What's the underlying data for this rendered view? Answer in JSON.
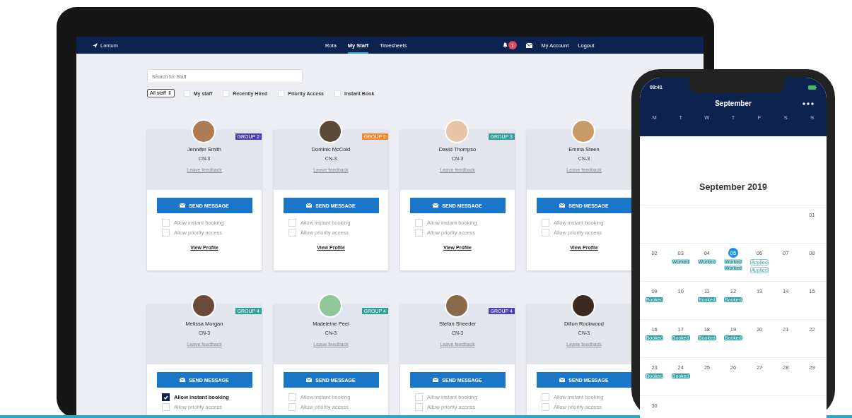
{
  "laptop": {
    "nav": {
      "brand": "Lantum",
      "links": [
        {
          "label": "Rota",
          "selected": false
        },
        {
          "label": "My Staff",
          "selected": true
        },
        {
          "label": "Timesheets",
          "selected": false
        }
      ],
      "notification_count": "1",
      "account": "My Account",
      "logout": "Logout"
    },
    "search": {
      "placeholder": "Search for Staff"
    },
    "filters": {
      "dropdown": "All staff ⇕",
      "options": [
        {
          "label": "My staff",
          "checked": false
        },
        {
          "label": "Recently Hired",
          "checked": false
        },
        {
          "label": "Priority Access",
          "checked": false
        },
        {
          "label": "Instant Book",
          "checked": false
        }
      ]
    },
    "staff": [
      {
        "name": "Jennifer Smith",
        "grade": "CN-3",
        "feedback": "Leave feedback",
        "badge": {
          "label": "GROUP 2",
          "color": "#4b3fb5"
        },
        "button": "SEND MESSAGE",
        "instant_booking": {
          "label": "Allow instant booking",
          "checked": false
        },
        "priority_access": {
          "label": "Allow priority access",
          "checked": false
        },
        "profile": "View Profile"
      },
      {
        "name": "Dominic McCold",
        "grade": "CN-3",
        "feedback": "Leave feedback",
        "badge": {
          "label": "GROUP 1",
          "color": "#f08a2c"
        },
        "button": "SEND MESSAGE",
        "instant_booking": {
          "label": "Allow instant booking",
          "checked": false
        },
        "priority_access": {
          "label": "Allow priority access",
          "checked": false
        },
        "profile": "View Profile"
      },
      {
        "name": "David Thompso",
        "grade": "CN-3",
        "feedback": "Leave feedback",
        "badge": {
          "label": "GROUP 3",
          "color": "#2e9e97"
        },
        "button": "SEND MESSAGE",
        "instant_booking": {
          "label": "Allow instant booking",
          "checked": false
        },
        "priority_access": {
          "label": "Allow priority access",
          "checked": false
        },
        "profile": "View Profile"
      },
      {
        "name": "Emma Steen",
        "grade": "CN-3",
        "feedback": "Leave feedback",
        "button": "SEND MESSAGE",
        "instant_booking": {
          "label": "Allow instant booking",
          "checked": false
        },
        "priority_access": {
          "label": "Allow priority access",
          "checked": false
        },
        "profile": "View Profile"
      },
      {
        "name": "Melissa Morgan",
        "grade": "CN-3",
        "feedback": "Leave feedback",
        "badge": {
          "label": "GROUP 4",
          "color": "#2e9e97"
        },
        "button": "SEND MESSAGE",
        "instant_booking": {
          "label": "Allow instant booking",
          "checked": true
        },
        "priority_access": {
          "label": "Allow priority access",
          "checked": false
        }
      },
      {
        "name": "Madeleine Peel",
        "grade": "CN-3",
        "feedback": "Leave feedback",
        "badge": {
          "label": "GROUP 4",
          "color": "#2e9e97"
        },
        "button": "SEND MESSAGE",
        "instant_booking": {
          "label": "Allow instant booking",
          "checked": false
        },
        "priority_access": {
          "label": "Allow priority access",
          "checked": false
        }
      },
      {
        "name": "Stefan Sheeder",
        "grade": "CN-3",
        "feedback": "Leave feedback",
        "badge": {
          "label": "GROUP 4",
          "color": "#4b3fb5"
        },
        "button": "SEND MESSAGE",
        "instant_booking": {
          "label": "Allow instant booking",
          "checked": false
        },
        "priority_access": {
          "label": "Allow priority access",
          "checked": false
        }
      },
      {
        "name": "Dillon Rockwood",
        "grade": "CN-3",
        "feedback": "Leave feedback",
        "button": "SEND MESSAGE",
        "instant_booking": {
          "label": "Allow instant booking",
          "checked": false
        },
        "priority_access": {
          "label": "Allow priority access",
          "checked": false
        }
      }
    ]
  },
  "phone": {
    "time": "09:41",
    "title": "September",
    "weekdays": [
      "M",
      "T",
      "W",
      "T",
      "F",
      "S",
      "S"
    ],
    "month": "September 2019",
    "weeks": [
      {
        "days": [
          {
            "date": "01",
            "selected": false
          }
        ]
      },
      {
        "days": [
          {
            "date": "02",
            "selected": false
          },
          {
            "date": "03",
            "selected": false,
            "events": [
              {
                "label": "Worked",
                "kind": "worked"
              }
            ]
          },
          {
            "date": "04",
            "selected": false,
            "events": [
              {
                "label": "Worked",
                "kind": "worked"
              }
            ]
          },
          {
            "date": "05",
            "selected": true,
            "events": [
              {
                "label": "Worked",
                "kind": "worked"
              },
              {
                "label": "Worked",
                "kind": "worked"
              }
            ]
          },
          {
            "date": "06",
            "selected": false,
            "events": [
              {
                "label": "Applied",
                "kind": "applied"
              },
              {
                "label": "Applied",
                "kind": "applied"
              }
            ]
          },
          {
            "date": "07",
            "selected": false
          },
          {
            "date": "08",
            "selected": false
          }
        ]
      },
      {
        "days": [
          {
            "date": "09",
            "selected": false,
            "events": [
              {
                "label": "Booked",
                "kind": "booked"
              }
            ]
          },
          {
            "date": "10",
            "selected": false
          },
          {
            "date": "11",
            "selected": false,
            "events": [
              {
                "label": "Booked",
                "kind": "booked"
              }
            ]
          },
          {
            "date": "12",
            "selected": false,
            "events": [
              {
                "label": "Booked",
                "kind": "booked"
              }
            ]
          },
          {
            "date": "13",
            "selected": false
          },
          {
            "date": "14",
            "selected": false
          },
          {
            "date": "15",
            "selected": false
          }
        ]
      },
      {
        "days": [
          {
            "date": "16",
            "selected": false,
            "events": [
              {
                "label": "Booked",
                "kind": "booked"
              }
            ]
          },
          {
            "date": "17",
            "selected": false,
            "events": [
              {
                "label": "Booked",
                "kind": "booked"
              }
            ]
          },
          {
            "date": "18",
            "selected": false,
            "events": [
              {
                "label": "Booked",
                "kind": "booked"
              }
            ]
          },
          {
            "date": "19",
            "selected": false,
            "events": [
              {
                "label": "Booked",
                "kind": "booked"
              }
            ]
          },
          {
            "date": "20",
            "selected": false
          },
          {
            "date": "21",
            "selected": false
          },
          {
            "date": "22",
            "selected": false
          }
        ]
      },
      {
        "days": [
          {
            "date": "23",
            "selected": false,
            "events": [
              {
                "label": "Booked",
                "kind": "booked"
              }
            ]
          },
          {
            "date": "24",
            "selected": false,
            "events": [
              {
                "label": "Booked",
                "kind": "booked"
              }
            ]
          },
          {
            "date": "25",
            "selected": false
          },
          {
            "date": "26",
            "selected": false
          },
          {
            "date": "27",
            "selected": false
          },
          {
            "date": "28",
            "selected": false
          },
          {
            "date": "29",
            "selected": false
          }
        ]
      },
      {
        "days": [
          {
            "date": "30",
            "selected": false
          }
        ]
      }
    ]
  }
}
